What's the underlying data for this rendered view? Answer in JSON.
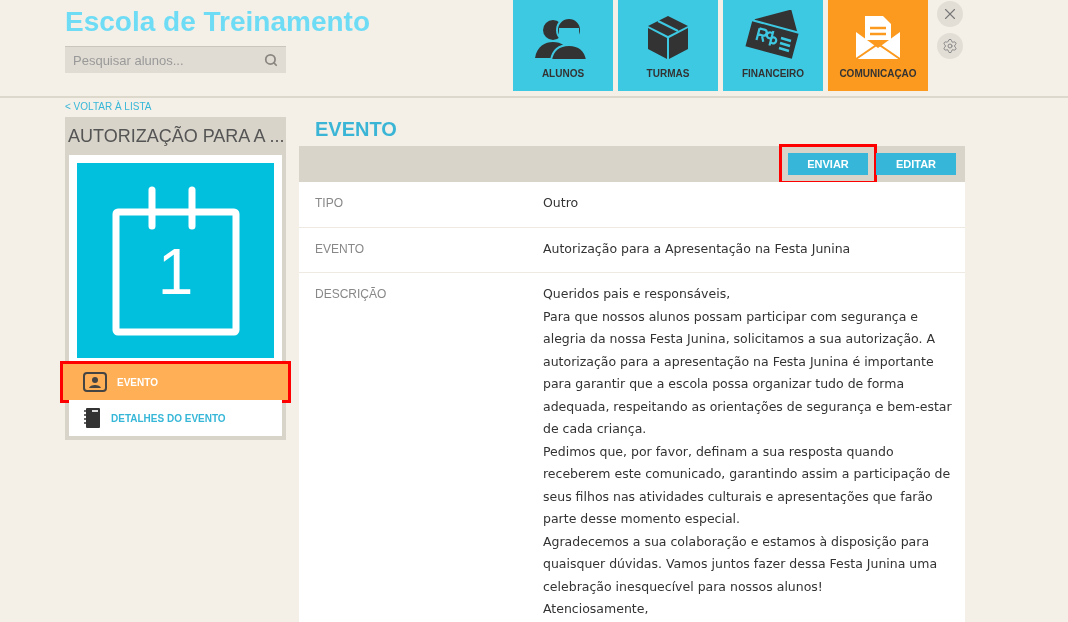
{
  "app_title": "Escola de Treinamento",
  "search": {
    "placeholder": "Pesquisar alunos..."
  },
  "nav": [
    {
      "label": "ALUNOS",
      "kind": "people",
      "selected": false
    },
    {
      "label": "TURMAS",
      "kind": "box",
      "selected": false
    },
    {
      "label": "FINANCEIRO",
      "kind": "money",
      "selected": false
    },
    {
      "label": "COMUNICAÇAO",
      "kind": "mail",
      "selected": true
    }
  ],
  "back_link": "< VOLTAR À LISTA",
  "sidebar": {
    "title": "AUTORIZAÇÃO PARA A ...",
    "day": "1",
    "items": [
      {
        "label": "EVENTO",
        "kind": "contact",
        "selected": true,
        "highlighted": true
      },
      {
        "label": "DETALHES DO EVENTO",
        "kind": "notebook",
        "selected": false,
        "highlighted": false
      }
    ]
  },
  "main": {
    "heading": "EVENTO",
    "buttons": [
      {
        "label": "ENVIAR",
        "highlighted": true
      },
      {
        "label": "EDITAR",
        "highlighted": false
      }
    ],
    "fields": [
      {
        "label": "TIPO",
        "value": [
          "Outro"
        ]
      },
      {
        "label": "EVENTO",
        "value": [
          "Autorização para a Apresentação na Festa Junina"
        ]
      },
      {
        "label": "DESCRIÇÃO",
        "value": [
          "Queridos pais e responsáveis,",
          "Para que nossos alunos possam participar com segurança e alegria da nossa Festa Junina, solicitamos a sua autorização. A autorização para a apresentação na Festa Junina é importante para garantir que a escola possa organizar tudo de forma adequada, respeitando as orientações de segurança e bem-estar de cada criança.",
          "Pedimos que, por favor, definam a sua resposta quando receberem este comunicado, garantindo assim a participação de seus filhos nas atividades culturais e apresentações que farão parte desse momento especial.",
          "Agradecemos a sua colaboração e estamos à disposição para quaisquer dúvidas. Vamos juntos fazer dessa Festa Junina uma celebração inesquecível para nossos alunos!",
          "Atenciosamente,"
        ]
      }
    ]
  }
}
